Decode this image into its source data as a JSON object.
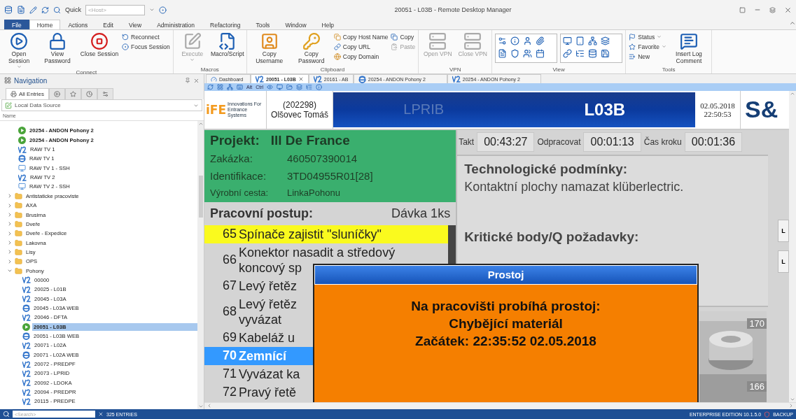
{
  "window": {
    "title": "20051 - L03B - Remote Desktop Manager"
  },
  "quick_access": {
    "label": "Quick",
    "placeholder": "<Host>"
  },
  "ribbon_tabs": [
    {
      "label": "File",
      "selected": false,
      "kind": "file"
    },
    {
      "label": "Home",
      "selected": true,
      "kind": "tab"
    },
    {
      "label": "Actions",
      "selected": false,
      "kind": "tab"
    },
    {
      "label": "Edit",
      "selected": false,
      "kind": "tab"
    },
    {
      "label": "View",
      "selected": false,
      "kind": "tab"
    },
    {
      "label": "Administration",
      "selected": false,
      "kind": "tab"
    },
    {
      "label": "Refactoring",
      "selected": false,
      "kind": "tab"
    },
    {
      "label": "Tools",
      "selected": false,
      "kind": "tab"
    },
    {
      "label": "Window",
      "selected": false,
      "kind": "tab"
    },
    {
      "label": "Help",
      "selected": false,
      "kind": "tab"
    }
  ],
  "ribbon_groups": [
    {
      "label": "Connect",
      "columns": [
        [
          {
            "label": "Open Session",
            "kind": "large",
            "disabled": false,
            "dropdown": true
          }
        ],
        [
          {
            "label": "View Password",
            "kind": "large",
            "disabled": false,
            "dropdown": false
          }
        ],
        [
          {
            "label": "Close Session",
            "kind": "large",
            "disabled": false,
            "dropdown": false
          }
        ],
        [
          {
            "label": "Reconnect",
            "kind": "small",
            "disabled": false,
            "dropdown": false
          },
          {
            "label": "Focus Session",
            "kind": "small",
            "disabled": false,
            "dropdown": false
          }
        ]
      ]
    },
    {
      "label": "Macros",
      "columns": [
        [
          {
            "label": "Execute",
            "kind": "large",
            "disabled": true,
            "dropdown": true
          }
        ],
        [
          {
            "label": "Macro/Script",
            "kind": "large",
            "disabled": false,
            "dropdown": false
          }
        ]
      ]
    },
    {
      "label": "Clipboard",
      "columns": [
        [
          {
            "label": "Copy Username",
            "kind": "large",
            "disabled": false,
            "dropdown": false
          }
        ],
        [
          {
            "label": "Copy Password",
            "kind": "large",
            "disabled": false,
            "dropdown": false
          }
        ],
        [
          {
            "label": "Copy Host Name",
            "kind": "small",
            "disabled": false,
            "dropdown": false
          },
          {
            "label": "Copy URL",
            "kind": "small",
            "disabled": false,
            "dropdown": false
          },
          {
            "label": "Copy Domain",
            "kind": "small",
            "disabled": false,
            "dropdown": false
          }
        ],
        [
          {
            "label": "Copy",
            "kind": "small",
            "disabled": false,
            "dropdown": false
          },
          {
            "label": "Paste",
            "kind": "small",
            "disabled": true,
            "dropdown": false
          }
        ]
      ]
    },
    {
      "label": "VPN",
      "columns": [
        [
          {
            "label": "Open VPN",
            "kind": "large",
            "disabled": true,
            "dropdown": false
          }
        ],
        [
          {
            "label": "Close VPN",
            "kind": "large",
            "disabled": true,
            "dropdown": false
          }
        ]
      ]
    },
    {
      "label": "View",
      "columns": [
        [
          {
            "kind": "gallery",
            "disabled": false,
            "dropdown": false
          }
        ],
        [
          {
            "kind": "gallery",
            "disabled": false,
            "dropdown": false
          }
        ]
      ]
    },
    {
      "label": "Tools",
      "columns": [
        [
          {
            "label": "Status",
            "kind": "small",
            "disabled": false,
            "dropdown": true
          },
          {
            "label": "Favorite",
            "kind": "small",
            "disabled": false,
            "dropdown": true
          },
          {
            "label": "New",
            "kind": "small",
            "disabled": false,
            "dropdown": false
          }
        ],
        [
          {
            "label": "Insert Log Comment",
            "kind": "large",
            "disabled": false,
            "dropdown": false
          }
        ]
      ]
    }
  ],
  "navigation": {
    "title": "Navigation",
    "tabs": [
      {
        "label": "All Entries",
        "selected": true
      },
      {
        "selected": false
      },
      {
        "selected": false
      },
      {
        "selected": false
      },
      {
        "selected": false
      }
    ],
    "data_source": "Local Data Source",
    "column": "Name",
    "tree": [
      {
        "label": "20254 - ANDON Pohony 2",
        "kind": "web",
        "open": true,
        "selected": false
      },
      {
        "label": "20254 - ANDON Pohony 2",
        "kind": "vnc",
        "open": true,
        "selected": false
      },
      {
        "label": "RAW TV 1",
        "kind": "vnc",
        "open": false,
        "selected": false
      },
      {
        "label": "RAW TV 1",
        "kind": "web",
        "open": false,
        "selected": false
      },
      {
        "label": "RAW TV 1 - SSH",
        "kind": "ssh",
        "open": false,
        "selected": false
      },
      {
        "label": "RAW TV 2",
        "kind": "vnc",
        "open": false,
        "selected": false
      },
      {
        "label": "RAW TV 2 - SSH",
        "kind": "ssh",
        "open": false,
        "selected": false
      },
      {
        "label": "Antistaticke pracoviste",
        "kind": "folder",
        "expanded": false,
        "selected": false
      },
      {
        "label": "AXA",
        "kind": "folder",
        "expanded": false,
        "selected": false
      },
      {
        "label": "Brusirna",
        "kind": "folder",
        "expanded": false,
        "selected": false
      },
      {
        "label": "Dveře",
        "kind": "folder",
        "expanded": false,
        "selected": false
      },
      {
        "label": "Dveře - Expedice",
        "kind": "folder",
        "expanded": false,
        "selected": false
      },
      {
        "label": "Lakovna",
        "kind": "folder",
        "expanded": false,
        "selected": false
      },
      {
        "label": "Lisy",
        "kind": "folder",
        "expanded": false,
        "selected": false
      },
      {
        "label": "OPS",
        "kind": "folder",
        "expanded": false,
        "selected": false
      },
      {
        "label": "Pohony",
        "kind": "folder",
        "expanded": true,
        "selected": false,
        "children": [
          {
            "label": "00000",
            "kind": "vnc",
            "open": false,
            "selected": false
          },
          {
            "label": "20025 - L01B",
            "kind": "vnc",
            "open": false,
            "selected": false
          },
          {
            "label": "20045 - L03A",
            "kind": "vnc",
            "open": false,
            "selected": false
          },
          {
            "label": "20045 - L03A WEB",
            "kind": "web",
            "open": false,
            "selected": false
          },
          {
            "label": "20046 - DFTA",
            "kind": "vnc",
            "open": false,
            "selected": false
          },
          {
            "label": "20051 - L03B",
            "kind": "vnc",
            "open": true,
            "selected": true
          },
          {
            "label": "20051 - L03B WEB",
            "kind": "web",
            "open": false,
            "selected": false
          },
          {
            "label": "20071 - L02A",
            "kind": "vnc",
            "open": false,
            "selected": false
          },
          {
            "label": "20071 - L02A WEB",
            "kind": "web",
            "open": false,
            "selected": false
          },
          {
            "label": "20072 - PREDPF",
            "kind": "vnc",
            "open": false,
            "selected": false
          },
          {
            "label": "20073 - LPRID",
            "kind": "vnc",
            "open": false,
            "selected": false
          },
          {
            "label": "20092 - LDOKA",
            "kind": "vnc",
            "open": false,
            "selected": false
          },
          {
            "label": "20094 - PREDPR",
            "kind": "vnc",
            "open": false,
            "selected": false
          },
          {
            "label": "20115 - PREDPE",
            "kind": "vnc",
            "open": false,
            "selected": false
          }
        ]
      }
    ]
  },
  "document_tabs": [
    {
      "label": "Dashboard",
      "kind": "dashboard",
      "selected": false
    },
    {
      "label": "20051 - L03B",
      "kind": "vnc",
      "selected": true
    },
    {
      "label": "20161 - AB",
      "kind": "vnc",
      "selected": false
    },
    {
      "label": "20254 - ANDON Pohony 2",
      "kind": "web",
      "selected": false
    },
    {
      "label": "20254 - ANDON Pohony 2",
      "kind": "vnc",
      "selected": false
    }
  ],
  "session_toolbar": {
    "keys": [
      "Alt",
      "Ctrl"
    ]
  },
  "remote": {
    "header": {
      "logo_mark": "iFE",
      "logo_tagline": "Innovations For Entrance Systems",
      "operator": "(202298) Olšovec Tomáš",
      "station": "LPRIB",
      "line": "L03B",
      "date": "02.05.2018",
      "time": "22:50:53",
      "brand": "S&"
    },
    "project": {
      "label": "Projekt:",
      "name": "Ill De France",
      "fields": [
        {
          "label": "Zakázka:",
          "value": "460507390014"
        },
        {
          "label": "Identifikace:",
          "value": "3TD04955R01[28]"
        },
        {
          "label": "Výrobní cesta:",
          "value": "LinkaPohonu"
        }
      ]
    },
    "procedure": {
      "title": "Pracovní postup:",
      "batch": "Dávka 1ks",
      "steps": [
        {
          "number": "65",
          "lines": [
            "Spínače zajistit \"sluníčky\""
          ],
          "current": true,
          "selected": false
        },
        {
          "number": "66",
          "lines": [
            "Konektor nasadit a středový",
            "koncový sp"
          ],
          "current": false,
          "selected": false
        },
        {
          "number": "67",
          "lines": [
            "Levý řetěz"
          ],
          "current": false,
          "selected": false
        },
        {
          "number": "68",
          "lines": [
            "Levý řetěz",
            "vyvázat"
          ],
          "current": false,
          "selected": false
        },
        {
          "number": "69",
          "lines": [
            "Kabeláž u"
          ],
          "current": false,
          "selected": false
        },
        {
          "number": "70",
          "lines": [
            "Zemnící"
          ],
          "current": false,
          "selected": true
        },
        {
          "number": "71",
          "lines": [
            "Vyvázat ka"
          ],
          "current": false,
          "selected": false
        },
        {
          "number": "72",
          "lines": [
            "Pravý řetě"
          ],
          "current": false,
          "selected": false
        }
      ]
    },
    "timers": [
      {
        "label": "Takt",
        "value": "00:43:27"
      },
      {
        "label": "Odpracovat",
        "value": "00:01:13"
      },
      {
        "label": "Čas kroku",
        "value": "00:01:36"
      }
    ],
    "conditions": {
      "title": "Technologické podmínky:",
      "text": "Kontaktní plochy namazat klüberlectric."
    },
    "critical": {
      "title": "Kritické body/Q požadavky:"
    },
    "photo": {
      "kind": "picture",
      "badges": [
        "170",
        "166"
      ]
    },
    "side_buttons": [
      "L",
      "L"
    ],
    "dialog": {
      "title": "Prostoj",
      "lines": [
        "Na pracovišti probíhá prostoj:",
        "Chybějící materiál",
        "Začátek: 22:35:52 02.05.2018"
      ]
    }
  },
  "status_bar": {
    "search_placeholder": "<Search>",
    "entries": "325 ENTRIES",
    "edition": "ENTERPRISE EDITION 10.1.5.0",
    "backup": "BACKUP"
  }
}
